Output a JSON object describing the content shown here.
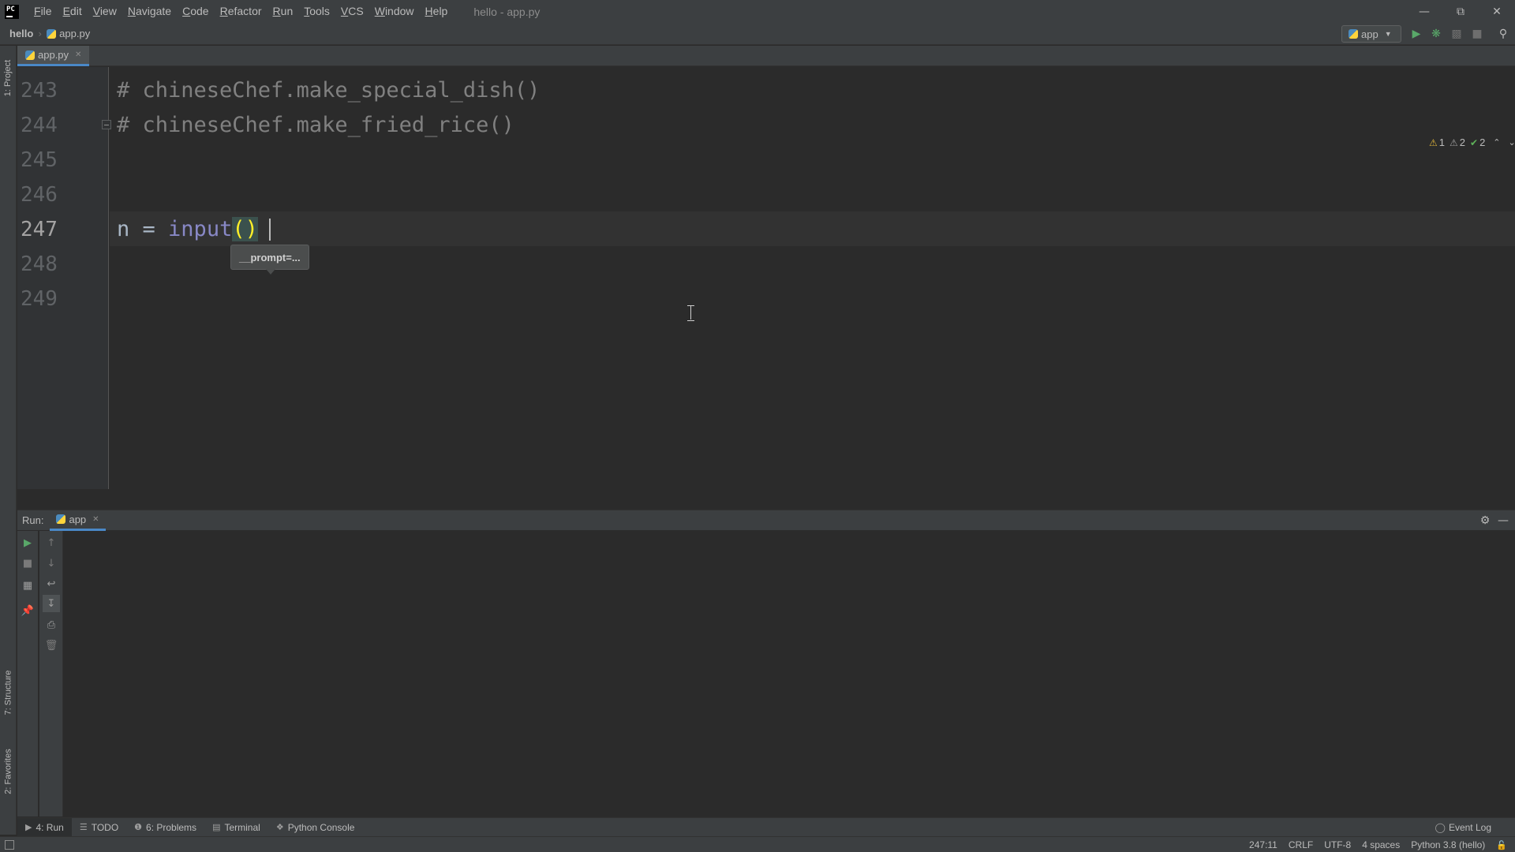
{
  "menu": {
    "items": [
      "File",
      "Edit",
      "View",
      "Navigate",
      "Code",
      "Refactor",
      "Run",
      "Tools",
      "VCS",
      "Window",
      "Help"
    ],
    "window_title": "hello - app.py",
    "logo_text": "PC"
  },
  "navbar": {
    "project": "hello",
    "file": "app.py",
    "run_config": "app"
  },
  "left_stripe": {
    "project": "1: Project",
    "structure": "7: Structure",
    "favorites": "2: Favorites"
  },
  "editor": {
    "tab_label": "app.py",
    "lines": [
      {
        "no": "243",
        "text": "# chineseChef.make_special_dish()"
      },
      {
        "no": "244",
        "text": "# chineseChef.make_fried_rice()"
      },
      {
        "no": "245",
        "text": ""
      },
      {
        "no": "246",
        "text": ""
      },
      {
        "no": "247",
        "var": "n",
        "op": " = ",
        "func": "input",
        "open": "(",
        "close": ")"
      },
      {
        "no": "248",
        "text": ""
      },
      {
        "no": "249",
        "text": ""
      }
    ],
    "param_hint": "__prompt=...",
    "inspections": {
      "warnings": "1",
      "weak_warnings": "2",
      "typos": "2"
    }
  },
  "run_window": {
    "label": "Run:",
    "tab": "app"
  },
  "bottom_tabs": {
    "run": "4: Run",
    "todo": "TODO",
    "problems": "6: Problems",
    "terminal": "Terminal",
    "python_console": "Python Console",
    "event_log": "Event Log"
  },
  "status": {
    "position": "247:11",
    "line_sep": "CRLF",
    "encoding": "UTF-8",
    "indent": "4 spaces",
    "interpreter": "Python 3.8 (hello)"
  },
  "colors": {
    "background": "#2b2b2b",
    "panel": "#3c3f41",
    "accent": "#4a88c7",
    "comment": "#808080",
    "builtin": "#8888c6",
    "brace_match": "#ffef28"
  }
}
